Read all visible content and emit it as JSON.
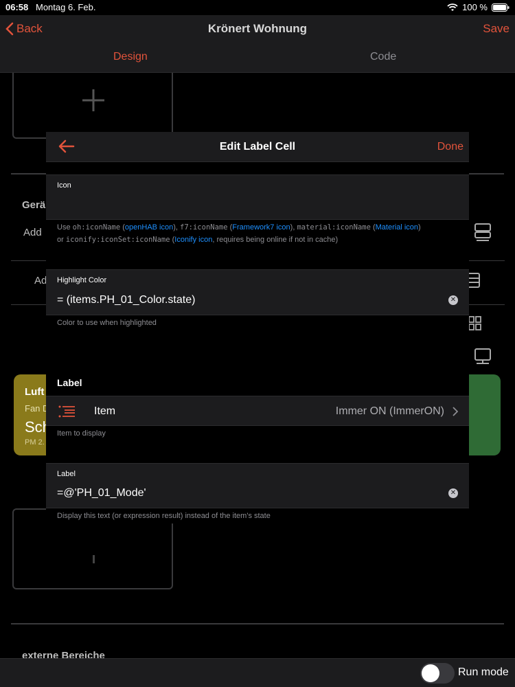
{
  "status": {
    "time": "06:58",
    "date": "Montag 6. Feb.",
    "battery": "100 %"
  },
  "nav": {
    "back": "Back",
    "title": "Krönert Wohnung",
    "save": "Save"
  },
  "tabs": {
    "design": "Design",
    "code": "Code"
  },
  "background": {
    "section1": "Gerä",
    "add1": "Add",
    "add2": "Ad",
    "card_left_title": "Luft",
    "card_left_sub": "Fan D",
    "card_left_big": "Sch",
    "card_left_small": "PM 2.",
    "section_bottom": "externe Bereiche",
    "colors": {
      "card_left": "#8a7a1b",
      "card_right": "#2f6b35"
    }
  },
  "modal": {
    "title": "Edit Label Cell",
    "done": "Done",
    "icon_field": {
      "label": "Icon",
      "value": "",
      "hint": {
        "p1": "Use ",
        "c1": "oh:iconName",
        "p2": " (",
        "l1": "openHAB icon",
        "p3": "), ",
        "c2": "f7:iconName",
        "p4": " (",
        "l2": "Framework7 icon",
        "p5": "), ",
        "c3": "material:iconName",
        "p6": " (",
        "l3": "Material icon",
        "p7": ")",
        "p8": "or ",
        "c4": "iconify:iconSet:iconName",
        "p9": " (",
        "l4": "Iconify icon",
        "p10": ", requires being online if not in cache)"
      }
    },
    "highlight": {
      "label": "Highlight Color",
      "value": "= (items.PH_01_Color.state)",
      "hint": "Color to use when highlighted"
    },
    "label_section": {
      "title": "Label",
      "item_label": "Item",
      "item_value": "Immer ON (ImmerON)",
      "item_hint": "Item to display",
      "label_field_label": "Label",
      "label_value": "=@'PH_01_Mode'",
      "label_hint": "Display this text (or expression result) instead of the item's state"
    }
  },
  "footer": {
    "run_mode": "Run mode"
  },
  "colors": {
    "accent": "#e2533b",
    "link": "#1e90ff"
  }
}
